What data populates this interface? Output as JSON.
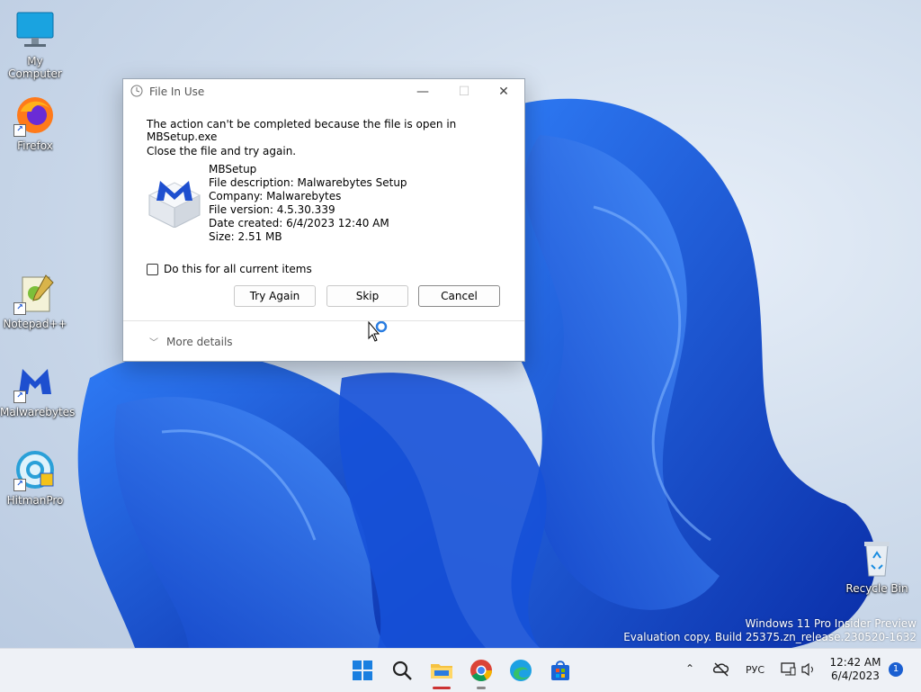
{
  "desktop": {
    "icons": [
      {
        "label": "My Computer",
        "icon": "computer-icon"
      },
      {
        "label": "Firefox",
        "icon": "firefox-icon"
      },
      {
        "label": "Notepad++",
        "icon": "notepadpp-icon"
      },
      {
        "label": "Malwarebytes",
        "icon": "malwarebytes-icon"
      },
      {
        "label": "HitmanPro",
        "icon": "hitmanpro-icon"
      },
      {
        "label": "Recycle Bin",
        "icon": "recycle-bin-icon"
      }
    ]
  },
  "dialog": {
    "title": "File In Use",
    "message": "The action can't be completed because the file is open in MBSetup.exe",
    "instruction": "Close the file and try again.",
    "file": {
      "name": "MBSetup",
      "description": "File description: Malwarebytes Setup",
      "company": "Company: Malwarebytes",
      "version": "File version: 4.5.30.339",
      "created": "Date created: 6/4/2023 12:40 AM",
      "size": "Size: 2.51 MB"
    },
    "checkbox_label": "Do this for all current items",
    "checkbox_checked": false,
    "buttons": {
      "try_again": "Try Again",
      "skip": "Skip",
      "cancel": "Cancel"
    },
    "more_details": "More details"
  },
  "watermark": {
    "line1": "Windows 11 Pro Insider Preview",
    "line2": "Evaluation copy. Build 25375.zn_release.230520-1632"
  },
  "taskbar": {
    "apps": [
      "start-icon",
      "search-icon",
      "file-explorer-icon",
      "chrome-icon",
      "edge-icon",
      "store-icon"
    ],
    "language": "РУС",
    "time": "12:42 AM",
    "date": "6/4/2023",
    "notification_count": "1"
  },
  "colors": {
    "accent": "#1a5fd1",
    "malwarebytes_blue": "#1e4fcf"
  }
}
